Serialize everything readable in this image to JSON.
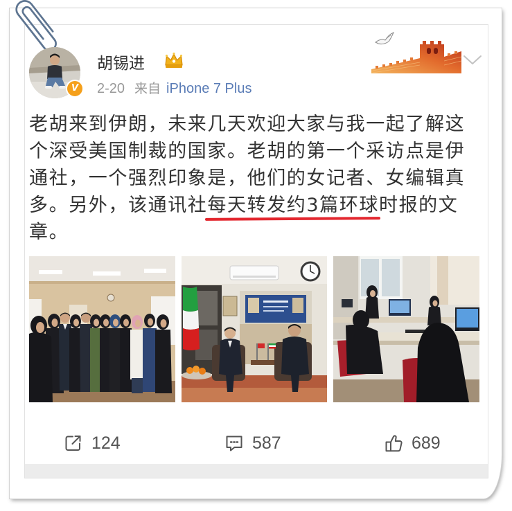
{
  "post": {
    "author": {
      "name": "胡锡进",
      "verified_label": "V"
    },
    "meta": {
      "date": "2-20",
      "source_prefix": "来自",
      "source": "iPhone 7 Plus"
    },
    "text_lines": [
      "老胡来到伊朗，未来几天欢迎大家与我一起了解这",
      "个深受美国制裁的国家。老胡的第一个采访点是伊",
      "通社，一个强烈印象是，他们的女记者、女编辑真"
    ],
    "highlight_line": {
      "before": "多。另外，该通讯社",
      "highlight": "每天转发约3篇环球",
      "after": "时报的文"
    },
    "last_line": "章。"
  },
  "actions": {
    "reposts": "124",
    "comments": "587",
    "likes": "689"
  },
  "icons": {
    "avatar_badge": "verified-v-icon",
    "member_badge": "crown-icon",
    "menu": "chevron-down-icon",
    "repost": "share-icon",
    "comment": "comment-icon",
    "like": "thumbs-up-icon",
    "clip": "paperclip-icon"
  },
  "colors": {
    "text": "#333333",
    "meta": "#999999",
    "source_link": "#5a7cb6",
    "underline": "#e3262e",
    "verified": "#f5a01b",
    "member_crown": "#f2b21c",
    "action": "#555555",
    "footer_strip": "#ececec"
  }
}
